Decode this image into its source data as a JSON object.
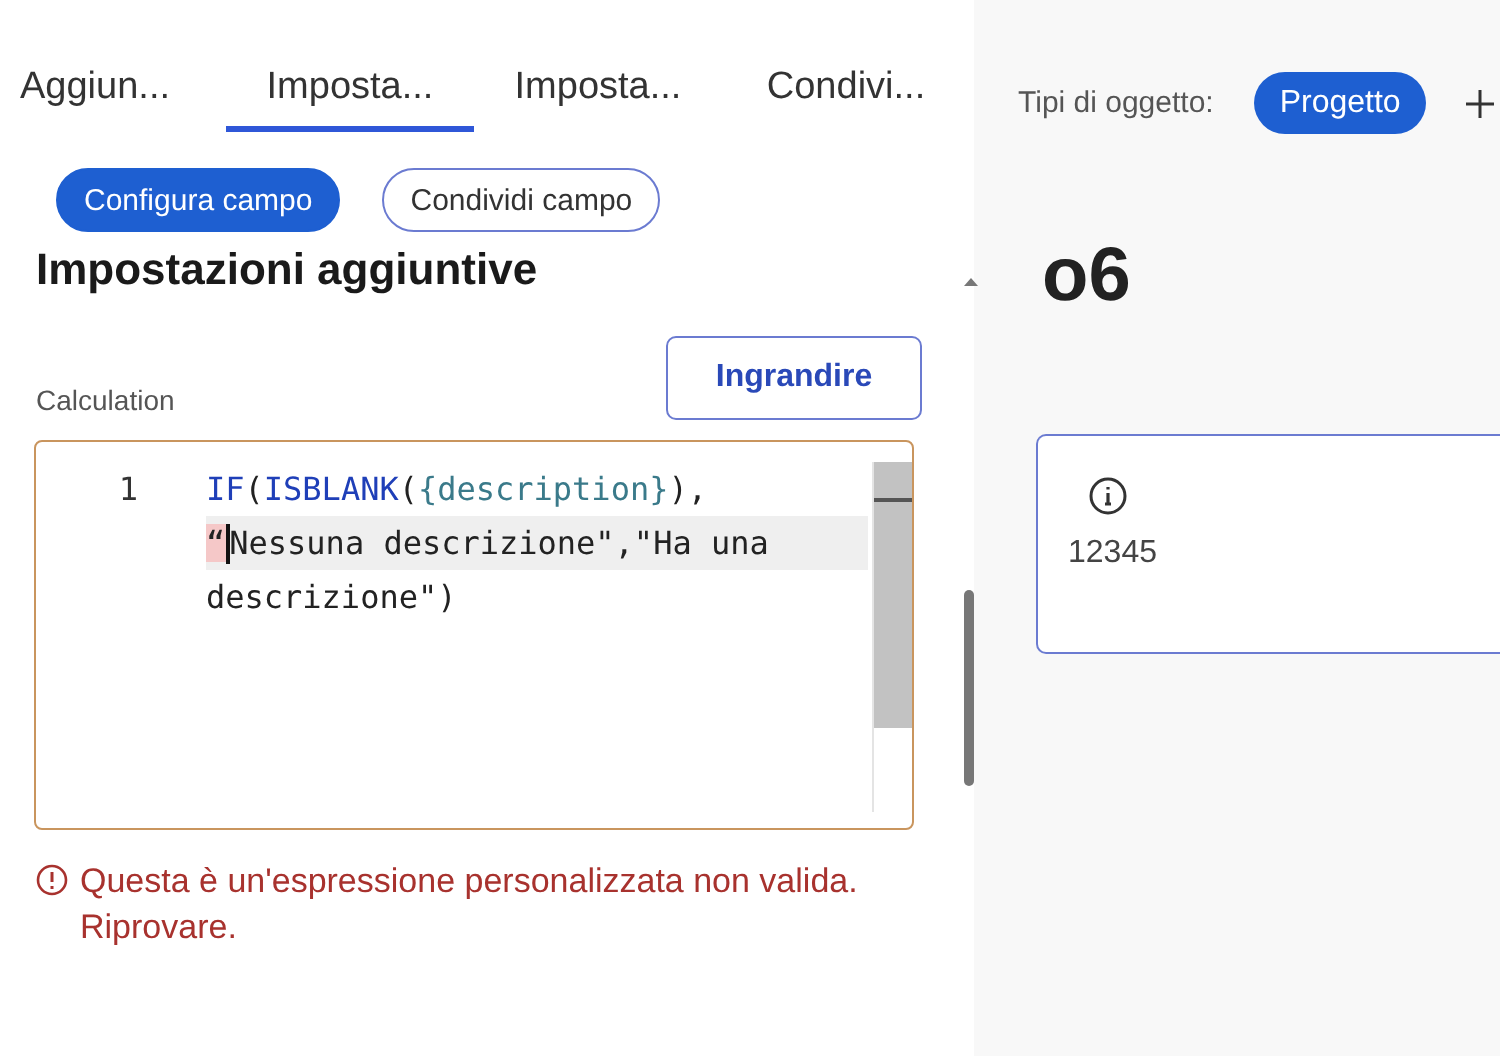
{
  "tabs": [
    {
      "label": "Aggiun...",
      "selected": false
    },
    {
      "label": "Imposta...",
      "selected": true
    },
    {
      "label": "Imposta...",
      "selected": false
    },
    {
      "label": "Condivi...",
      "selected": false
    }
  ],
  "mode_buttons": [
    {
      "label": "Configura campo",
      "selected": true
    },
    {
      "label": "Condividi campo",
      "selected": false
    }
  ],
  "heading": "Impostazioni aggiuntive",
  "field_label": "Calculation",
  "expand_button": "Ingrandire",
  "editor": {
    "rows": [
      {
        "line_number": "1",
        "active": false,
        "tokens": [
          {
            "text": "IF",
            "kind": "keyword"
          },
          {
            "text": "(",
            "kind": "punct"
          },
          {
            "text": "ISBLANK",
            "kind": "keyword"
          },
          {
            "text": "(",
            "kind": "punct"
          },
          {
            "text": "{description}",
            "kind": "field"
          },
          {
            "text": "),",
            "kind": "punct"
          }
        ]
      },
      {
        "active": true,
        "tokens": [
          {
            "text": "“",
            "kind": "error"
          },
          {
            "text": "Nessuna descrizione\",\"Ha una",
            "kind": "string"
          }
        ]
      },
      {
        "active": false,
        "tokens": [
          {
            "text": "descrizione\")",
            "kind": "string"
          }
        ]
      }
    ]
  },
  "error_message": "Questa è un'espressione personalizzata non valida. Riprovare.",
  "side": {
    "object_types_label": "Tipi di oggetto:",
    "object_types": [
      {
        "label": "Progetto"
      }
    ],
    "title": "o6",
    "card": {
      "value": "12345"
    }
  }
}
